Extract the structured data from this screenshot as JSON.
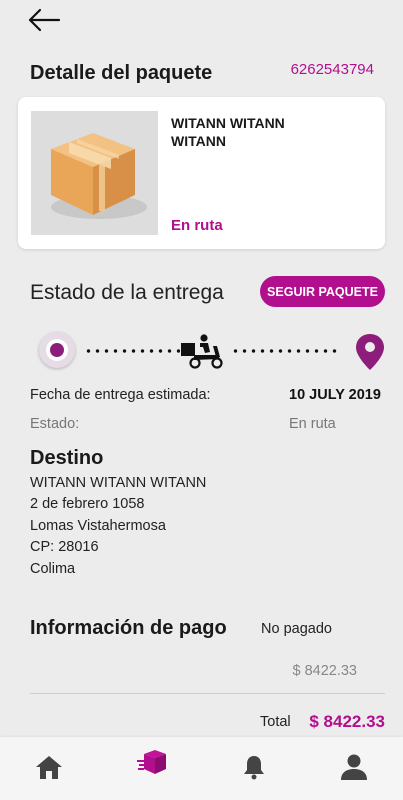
{
  "header": {
    "back_icon": "arrow-left-icon",
    "title": "Detalle del paquete",
    "tracking_number": "6262543794"
  },
  "package": {
    "image_icon": "cardboard-box-icon",
    "recipient": "WITANN WITANN WITANN",
    "status": "En ruta"
  },
  "delivery": {
    "heading": "Estado de la entrega",
    "follow_button": "SEGUIR PAQUETE",
    "icons": [
      "origin-marker-icon",
      "courier-scooter-icon",
      "location-pin-icon"
    ],
    "estimated_date_label": "Fecha de entrega estimada:",
    "estimated_date_value": "10 JULY 2019",
    "status_label": "Estado:",
    "status_value": "En ruta"
  },
  "destination": {
    "heading": "Destino",
    "lines": [
      "WITANN WITANN WITANN",
      "2 de febrero 1058",
      "Lomas Vistahermosa",
      "CP: 28016",
      "Colima"
    ]
  },
  "payment": {
    "heading": "Información de pago",
    "status": "No pagado",
    "subtotal": "$ 8422.33",
    "total_label": "Total",
    "total_amount": "$ 8422.33"
  },
  "nav": {
    "items": [
      {
        "icon": "home-icon",
        "active": false
      },
      {
        "icon": "package-icon",
        "active": true
      },
      {
        "icon": "bell-icon",
        "active": false
      },
      {
        "icon": "user-icon",
        "active": false
      }
    ]
  },
  "colors": {
    "accent": "#b10f8e",
    "background": "#ececec",
    "card": "#ffffff"
  }
}
